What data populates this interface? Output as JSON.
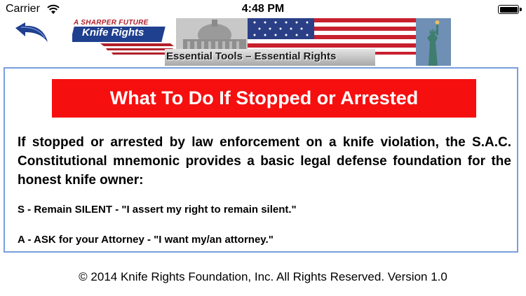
{
  "status_bar": {
    "carrier": "Carrier",
    "time": "4:48 PM",
    "battery_level": 1.0,
    "icons": [
      "wifi-icon",
      "battery-icon"
    ]
  },
  "header": {
    "back_icon": "back-arrow-icon",
    "logo_tagline": "A SHARPER FUTURE",
    "logo_name": "Knife Rights",
    "banner_tagline": "Essential Tools – Essential Rights"
  },
  "content": {
    "heading": "What To Do If Stopped or Arrested",
    "intro": "If stopped or arrested by law enforcement on a knife violation, the S.A.C. Constitutional mnemonic provides a basic legal defense foundation for the honest knife owner:",
    "items": [
      "S - Remain SILENT - \"I assert my right to remain silent.\"",
      "A - ASK for your Attorney - \"I want my/an attorney.\""
    ]
  },
  "footer": {
    "copyright": "© 2014 Knife Rights Foundation, Inc. All Rights Reserved. Version 1.0"
  },
  "colors": {
    "heading_bg": "#f60f0f",
    "border": "#7a9edc",
    "back_arrow": "#1f3f8f",
    "logo_blue": "#1f3f8f",
    "logo_red": "#b0202a"
  }
}
